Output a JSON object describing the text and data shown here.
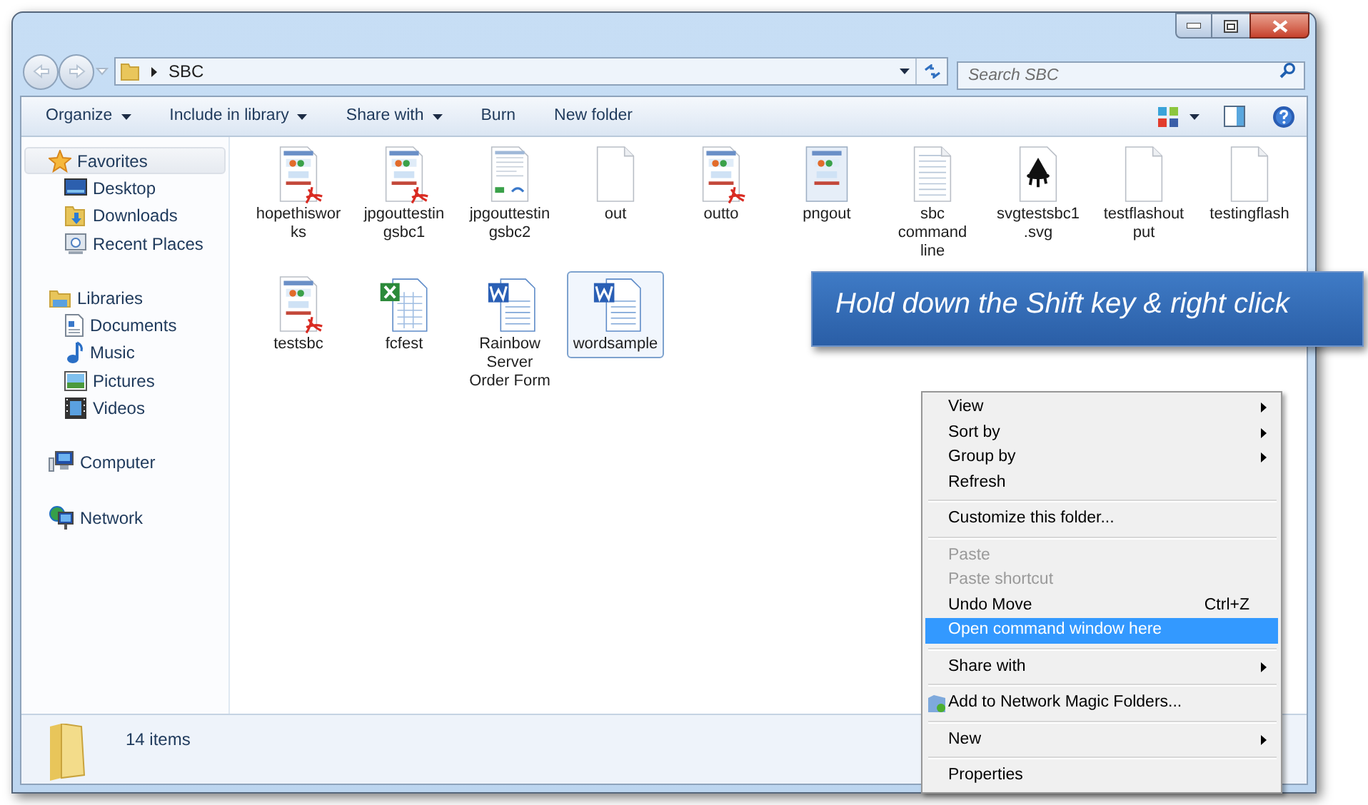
{
  "address_bar": {
    "path": "SBC"
  },
  "search": {
    "placeholder": "Search SBC"
  },
  "toolbar": {
    "buttons": [
      {
        "label": "Organize",
        "dropdown": true
      },
      {
        "label": "Include in library",
        "dropdown": true
      },
      {
        "label": "Share with",
        "dropdown": true
      },
      {
        "label": "Burn",
        "dropdown": false
      },
      {
        "label": "New folder",
        "dropdown": false
      }
    ]
  },
  "sidebar": {
    "groups": [
      {
        "label": "Favorites",
        "kind": "favorites",
        "highlighted": true,
        "children": [
          {
            "label": "Desktop",
            "kind": "desktop"
          },
          {
            "label": "Downloads",
            "kind": "downloads"
          },
          {
            "label": "Recent Places",
            "kind": "recent"
          }
        ]
      },
      {
        "label": "Libraries",
        "kind": "libraries",
        "highlighted": false,
        "children": [
          {
            "label": "Documents",
            "kind": "documents"
          },
          {
            "label": "Music",
            "kind": "music"
          },
          {
            "label": "Pictures",
            "kind": "pictures"
          },
          {
            "label": "Videos",
            "kind": "videos"
          }
        ]
      },
      {
        "label": "Computer",
        "kind": "computer",
        "highlighted": false
      },
      {
        "label": "Network",
        "kind": "network",
        "highlighted": false
      }
    ]
  },
  "files": [
    {
      "name": "hopethisworks",
      "kind": "pdf",
      "selected": false
    },
    {
      "name": "jpgouttestingsbc1",
      "kind": "pdf",
      "selected": false
    },
    {
      "name": "jpgouttestingsbc2",
      "kind": "document",
      "selected": false
    },
    {
      "name": "out",
      "kind": "blank",
      "selected": false
    },
    {
      "name": "outto",
      "kind": "pdf",
      "selected": false
    },
    {
      "name": "pngout",
      "kind": "image",
      "selected": false
    },
    {
      "name": "sbc command line",
      "kind": "text",
      "selected": false
    },
    {
      "name": "svgtestsbc1.svg",
      "kind": "svg",
      "selected": false
    },
    {
      "name": "testflashoutput",
      "kind": "blank",
      "selected": false
    },
    {
      "name": "testingflash",
      "kind": "blank",
      "selected": false
    },
    {
      "name": "testsbc",
      "kind": "pdf",
      "selected": false
    },
    {
      "name": "fcfest",
      "kind": "excel",
      "selected": false
    },
    {
      "name": "Rainbow Server Order Form",
      "kind": "word",
      "selected": false
    },
    {
      "name": "wordsample",
      "kind": "word",
      "selected": true
    }
  ],
  "status_bar": {
    "count": "14 items"
  },
  "callout": {
    "text": "Hold down the Shift key & right click"
  },
  "context_menu": {
    "groups": [
      [
        {
          "label": "View",
          "submenu": true,
          "disabled": false,
          "selected": false
        },
        {
          "label": "Sort by",
          "submenu": true,
          "disabled": false,
          "selected": false
        },
        {
          "label": "Group by",
          "submenu": true,
          "disabled": false,
          "selected": false
        },
        {
          "label": "Refresh",
          "submenu": false,
          "disabled": false,
          "selected": false
        }
      ],
      [
        {
          "label": "Customize this folder...",
          "submenu": false,
          "disabled": false,
          "selected": false
        }
      ],
      [
        {
          "label": "Paste",
          "submenu": false,
          "disabled": true,
          "selected": false
        },
        {
          "label": "Paste shortcut",
          "submenu": false,
          "disabled": true,
          "selected": false
        },
        {
          "label": "Undo Move",
          "shortcut": "Ctrl+Z",
          "submenu": false,
          "disabled": false,
          "selected": false
        },
        {
          "label": "Open command window here",
          "submenu": false,
          "disabled": false,
          "selected": true
        }
      ],
      [
        {
          "label": "Share with",
          "submenu": true,
          "disabled": false,
          "selected": false
        }
      ],
      [
        {
          "label": "Add to Network Magic Folders...",
          "icon": true,
          "submenu": false,
          "disabled": false,
          "selected": false
        }
      ],
      [
        {
          "label": "New",
          "submenu": true,
          "disabled": false,
          "selected": false
        }
      ],
      [
        {
          "label": "Properties",
          "submenu": false,
          "disabled": false,
          "selected": false
        }
      ]
    ]
  }
}
